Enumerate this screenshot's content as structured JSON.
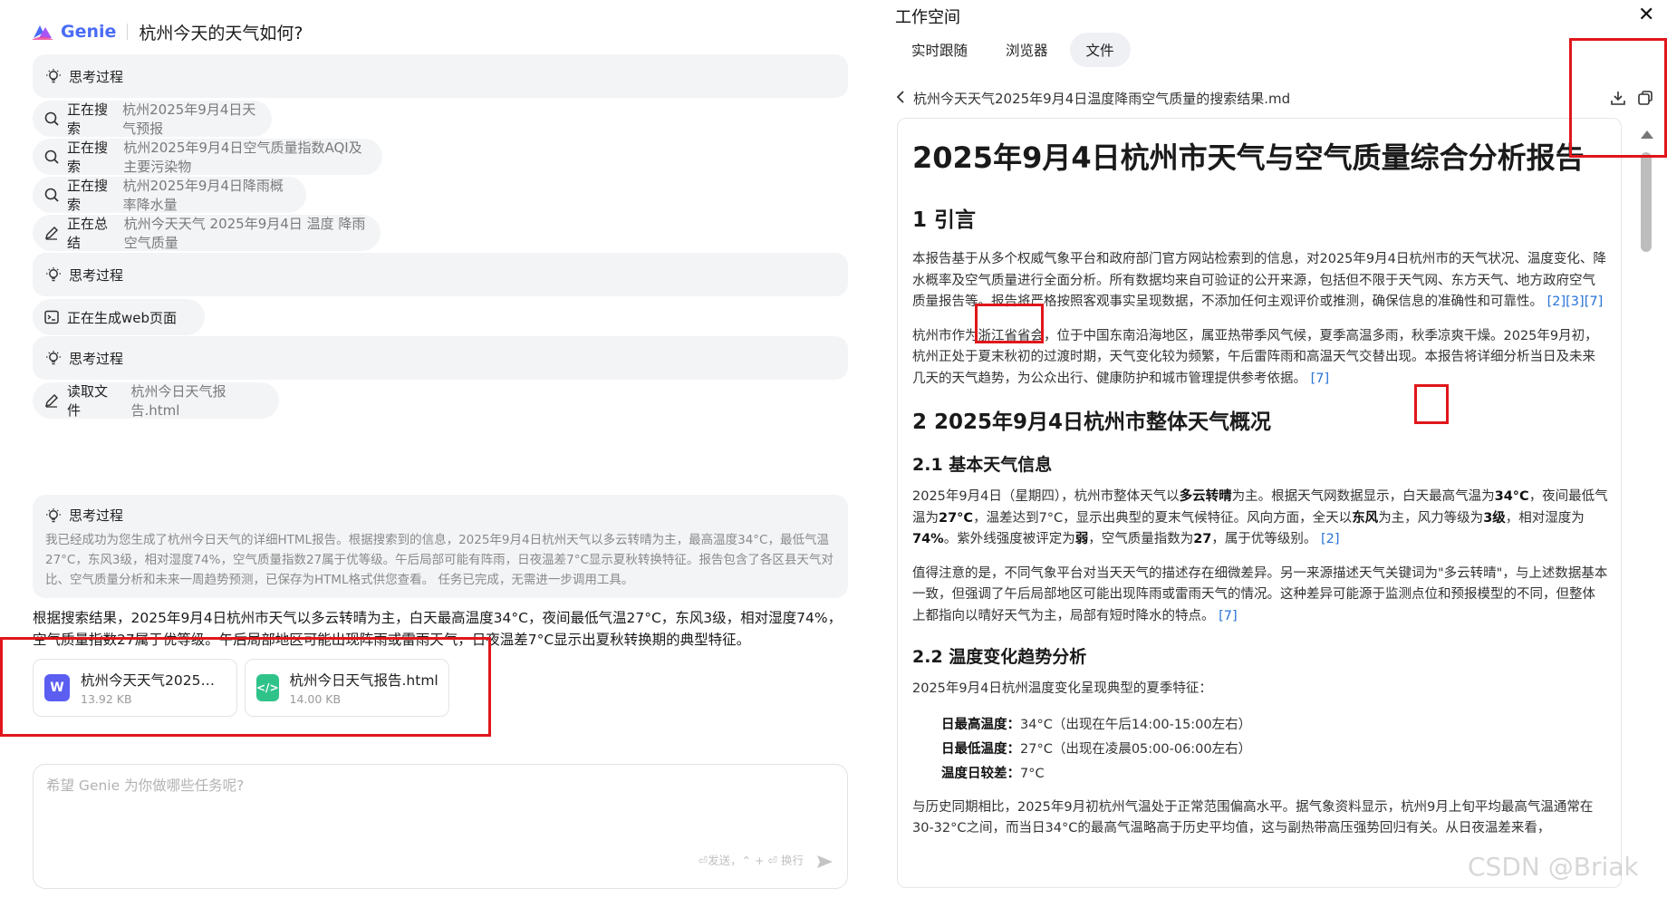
{
  "app": {
    "name": "Genie",
    "chat_title": "杭州今天的天气如何?"
  },
  "chat": {
    "think_label": "思考过程",
    "steps": [
      {
        "verb": "正在搜索",
        "query": "杭州2025年9月4日天气预报"
      },
      {
        "verb": "正在搜索",
        "query": "杭州2025年9月4日空气质量指数AQI及主要污染物"
      },
      {
        "verb": "正在搜索",
        "query": "杭州2025年9月4日降雨概率降水量"
      },
      {
        "verb": "正在总结",
        "query": "杭州今天天气 2025年9月4日 温度 降雨 空气质量"
      },
      {
        "verb": "正在生成web页面",
        "query": ""
      },
      {
        "verb": "读取文件",
        "query": "杭州今日天气报告.html"
      }
    ],
    "final_think": "我已经成功为您生成了杭州今日天气的详细HTML报告。根据搜索到的信息，2025年9月4日杭州天气以多云转晴为主，最高温度34°C，最低气温27°C，东风3级，相对湿度74%，空气质量指数27属于优等级。午后局部可能有阵雨，日夜温差7°C显示夏秋转换特征。报告包含了各区县天气对比、空气质量分析和未来一周趋势预测，已保存为HTML格式供您查看。 任务已完成，无需进一步调用工具。",
    "answer": "根据搜索结果，2025年9月4日杭州市天气以多云转晴为主，白天最高温度34°C，夜间最低气温27°C，东风3级，相对湿度74%，空气质量指数27属于优等级。午后局部地区可能出现阵雨或雷雨天气，日夜温差7°C显示出夏秋转换期的典型特征。",
    "files": [
      {
        "name": "杭州今天天气2025年...",
        "size": "13.92 KB",
        "icon": "word-doc-icon",
        "color": "#5b5ef0"
      },
      {
        "name": "杭州今日天气报告.html",
        "size": "14.00 KB",
        "icon": "html-code-icon",
        "color": "#2fc38a"
      }
    ],
    "composer_placeholder": "希望 Genie 为你做哪些任务呢?",
    "send_hint": "⏎发送，⌃ + ⏎ 换行"
  },
  "workspace": {
    "title": "工作空间",
    "close": "✕",
    "tabs": [
      "实时跟随",
      "浏览器",
      "文件"
    ],
    "active_tab": 2,
    "file_path": "杭州今天天气2025年9月4日温度降雨空气质量的搜索结果.md",
    "doc": {
      "title": "2025年9月4日杭州市天气与空气质量综合分析报告",
      "s1": "1 引言",
      "p1": "本报告基于从多个权威气象平台和政府部门官方网站检索到的信息，对2025年9月4日杭州市的天气状况、温度变化、降水概率及空气质量进行全面分析。所有数据均来自可验证的公开来源，包括但不限于天气网、东方天气、地方政府空气质量报告等。报告将严格按照客观事实呈现数据，不添加任何主观评价或推测，确保信息的准确性和可靠性。",
      "p1_ref": "[2][3][7]",
      "p2": "杭州市作为浙江省省会，位于中国东南沿海地区，属亚热带季风气候，夏季高温多雨，秋季凉爽干燥。2025年9月初，杭州正处于夏末秋初的过渡时期，天气变化较为频繁，午后雷阵雨和高温天气交替出现。本报告将详细分析当日及未来几天的天气趋势，为公众出行、健康防护和城市管理提供参考依据。",
      "p2_ref": "[7]",
      "s2": "2 2025年9月4日杭州市整体天气概况",
      "s21": "2.1 基本天气信息",
      "p3": {
        "a": "2025年9月4日（星期四），杭州市整体天气以",
        "b": "多云转晴",
        "c": "为主。根据天气网数据显示，白天最高气温为",
        "d": "34°C",
        "e": "，夜间最低气温为",
        "f": "27°C",
        "g": "，温差达到7°C，显示出典型的夏末气候特征。风向方面，全天以",
        "h": "东风",
        "i": "为主，风力等级为",
        "j": "3级",
        "k": "，相对湿度为",
        "l": "74%",
        "m": "。紫外线强度被评定为",
        "n": "弱",
        "o": "，空气质量指数为",
        "p": "27",
        "q": "，属于优等级别。",
        "ref": "[2]"
      },
      "p4": "值得注意的是，不同气象平台对当天天气的描述存在细微差异。另一来源描述天气关键词为\"多云转晴\"，与上述数据基本一致，但强调了午后局部地区可能出现阵雨或雷雨天气的情况。这种差异可能源于监测点位和预报模型的不同，但整体上都指向以晴好天气为主，局部有短时降水的特点。",
      "p4_ref": "[7]",
      "s22": "2.2 温度变化趋势分析",
      "p5": "2025年9月4日杭州温度变化呈现典型的夏季特征：",
      "list": [
        {
          "k": "日最高温度：",
          "v": "34°C（出现在午后14:00-15:00左右）"
        },
        {
          "k": "日最低温度：",
          "v": "27°C（出现在凌晨05:00-06:00左右）"
        },
        {
          "k": "温度日较差：",
          "v": "7°C"
        }
      ],
      "p6": "与历史同期相比，2025年9月初杭州气温处于正常范围偏高水平。据气象资料显示，杭州9月上旬平均最高气温通常在30-32°C之间，而当日34°C的最高气温略高于历史平均值，这与副热带高压强势回归有关。从日夜温差来看，"
    }
  },
  "watermark": "CSDN @Briak"
}
